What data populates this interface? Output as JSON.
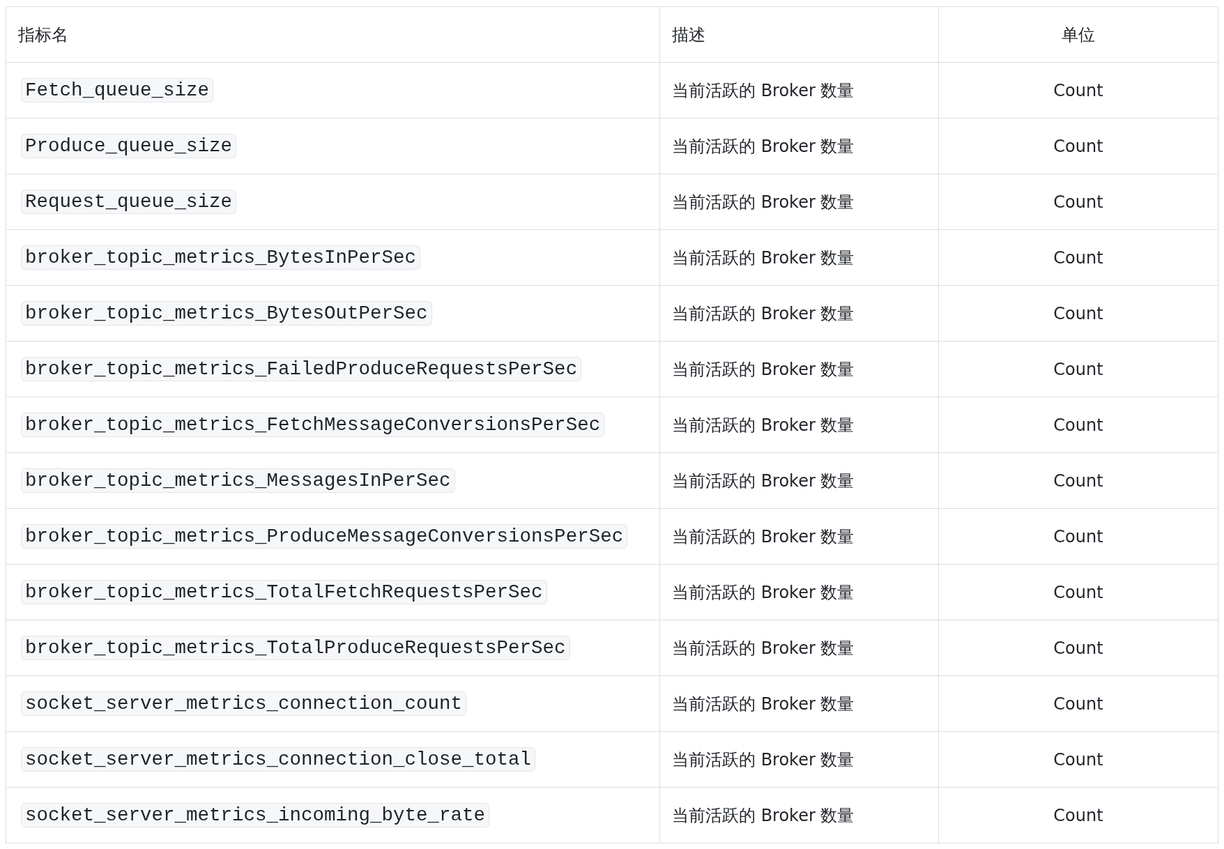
{
  "table": {
    "columns": [
      "指标名",
      "描述",
      "单位"
    ],
    "rows": [
      {
        "metric": "Fetch_queue_size",
        "description": "当前活跃的 Broker 数量",
        "unit": "Count"
      },
      {
        "metric": "Produce_queue_size",
        "description": "当前活跃的 Broker 数量",
        "unit": "Count"
      },
      {
        "metric": "Request_queue_size",
        "description": "当前活跃的 Broker 数量",
        "unit": "Count"
      },
      {
        "metric": "broker_topic_metrics_BytesInPerSec",
        "description": "当前活跃的 Broker 数量",
        "unit": "Count"
      },
      {
        "metric": "broker_topic_metrics_BytesOutPerSec",
        "description": "当前活跃的 Broker 数量",
        "unit": "Count"
      },
      {
        "metric": "broker_topic_metrics_FailedProduceRequestsPerSec",
        "description": "当前活跃的 Broker 数量",
        "unit": "Count"
      },
      {
        "metric": "broker_topic_metrics_FetchMessageConversionsPerSec",
        "description": "当前活跃的 Broker 数量",
        "unit": "Count"
      },
      {
        "metric": "broker_topic_metrics_MessagesInPerSec",
        "description": "当前活跃的 Broker 数量",
        "unit": "Count"
      },
      {
        "metric": "broker_topic_metrics_ProduceMessageConversionsPerSec",
        "description": "当前活跃的 Broker 数量",
        "unit": "Count"
      },
      {
        "metric": "broker_topic_metrics_TotalFetchRequestsPerSec",
        "description": "当前活跃的 Broker 数量",
        "unit": "Count"
      },
      {
        "metric": "broker_topic_metrics_TotalProduceRequestsPerSec",
        "description": "当前活跃的 Broker 数量",
        "unit": "Count"
      },
      {
        "metric": "socket_server_metrics_connection_count",
        "description": "当前活跃的 Broker 数量",
        "unit": "Count"
      },
      {
        "metric": "socket_server_metrics_connection_close_total",
        "description": "当前活跃的 Broker 数量",
        "unit": "Count"
      },
      {
        "metric": "socket_server_metrics_incoming_byte_rate",
        "description": "当前活跃的 Broker 数量",
        "unit": "Count"
      }
    ]
  }
}
